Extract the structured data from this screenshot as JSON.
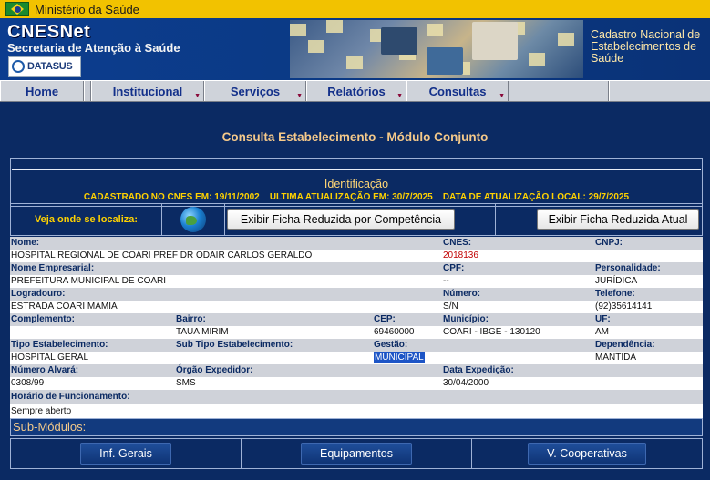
{
  "gov_bar": {
    "name": "Ministério da Saúde"
  },
  "header": {
    "title": "CNESNet",
    "subtitle": "Secretaria de Atenção à Saúde",
    "logo_text": "DATASUS",
    "cadastro_line1": "Cadastro Nacional de",
    "cadastro_line2": "Estabelecimentos de",
    "cadastro_line3": "Saúde"
  },
  "menu": {
    "items": [
      {
        "label": "Home"
      },
      {
        "label": "Institucional"
      },
      {
        "label": "Serviços"
      },
      {
        "label": "Relatórios"
      },
      {
        "label": "Consultas"
      }
    ]
  },
  "page": {
    "title": "Consulta Estabelecimento - Módulo Conjunto",
    "identificacao": "Identificação",
    "dates": "CADASTRADO NO CNES EM: 19/11/2002    ULTIMA ATUALIZAÇÃO EM: 30/7/2025    DATA DE ATUALIZAÇÃO LOCAL: 29/7/2025",
    "veja_onde": "Veja onde se localiza:",
    "btn_ficha_competencia": "Exibir Ficha Reduzida por Competência",
    "btn_ficha_atual": "Exibir Ficha Reduzida Atual"
  },
  "fields": {
    "nome_label": "Nome:",
    "nome": "HOSPITAL REGIONAL DE COARI PREF DR ODAIR CARLOS GERALDO",
    "cnes_label": "CNES:",
    "cnes": "2018136",
    "cnpj_label": "CNPJ:",
    "cnpj": "",
    "nome_empresarial_label": "Nome Empresarial:",
    "nome_empresarial": "PREFEITURA MUNICIPAL DE COARI",
    "cpf_label": "CPF:",
    "cpf": "--",
    "personalidade_label": "Personalidade:",
    "personalidade": "JURÍDICA",
    "logradouro_label": "Logradouro:",
    "logradouro": "ESTRADA COARI MAMIA",
    "numero_label": "Número:",
    "numero": "S/N",
    "telefone_label": "Telefone:",
    "telefone": "(92)35614141",
    "complemento_label": "Complemento:",
    "complemento": "",
    "bairro_label": "Bairro:",
    "bairro": "TAUA MIRIM",
    "cep_label": "CEP:",
    "cep": "69460000",
    "municipio_label": "Município:",
    "municipio": "COARI - IBGE - 130120",
    "uf_label": "UF:",
    "uf": "AM",
    "tipo_label": "Tipo Estabelecimento:",
    "tipo": "HOSPITAL GERAL",
    "subtipo_label": "Sub Tipo Estabelecimento:",
    "subtipo": "",
    "gestao_label": "Gestão:",
    "gestao": "MUNICIPAL",
    "dependencia_label": "Dependência:",
    "dependencia": "MANTIDA",
    "alvara_label": "Número Alvará:",
    "alvara": "0308/99",
    "orgao_label": "Órgão Expedidor:",
    "orgao": "SMS",
    "data_exp_label": "Data Expedição:",
    "data_exp": "30/04/2000",
    "horario_label": "Horário de Funcionamento:",
    "horario": "Sempre aberto"
  },
  "submodulos": {
    "title": "Sub-Módulos:",
    "buttons": [
      "Inf. Gerais",
      "Equipamentos",
      "V. Cooperativas"
    ]
  },
  "colors": {
    "page_bg": "#0b2a63",
    "gov_bar": "#f2c200",
    "accent_title": "#f5c98a",
    "label_text": "#0b2a63",
    "cnes_value": "#c10000"
  }
}
